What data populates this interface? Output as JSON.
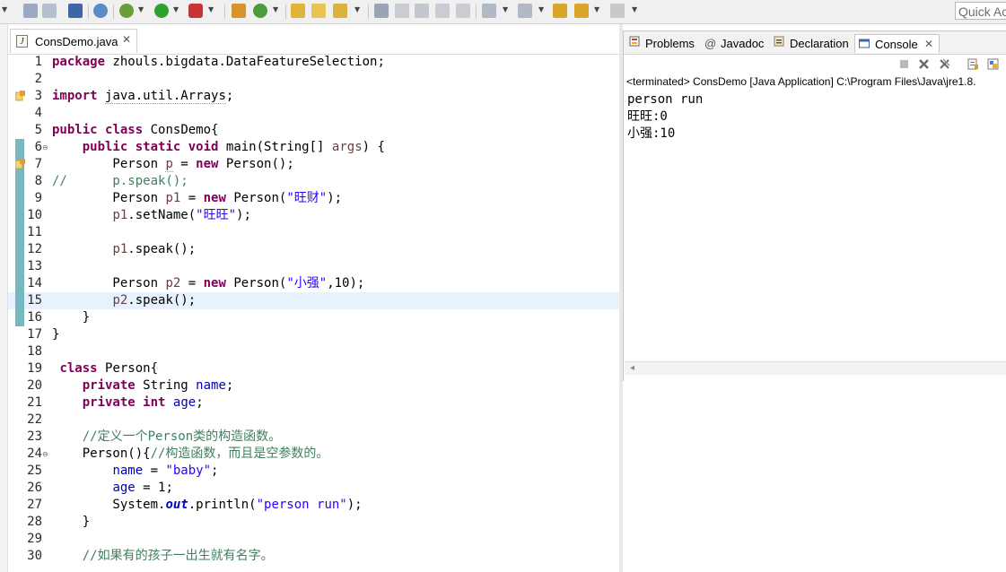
{
  "toolbar": {
    "quick_access_placeholder": "Quick Access"
  },
  "editor": {
    "tab_label": "ConsDemo.java",
    "lines": [
      {
        "n": "1",
        "t": "package zhouls.bigdata.DataFeatureSelection;"
      },
      {
        "n": "2",
        "t": ""
      },
      {
        "n": "3",
        "t": "import java.util.Arrays;"
      },
      {
        "n": "4",
        "t": ""
      },
      {
        "n": "5",
        "t": "public class ConsDemo{"
      },
      {
        "n": "6",
        "t": "    public static void main(String[] args) {"
      },
      {
        "n": "7",
        "t": "        Person p = new Person();"
      },
      {
        "n": "8",
        "t": "//      p.speak();"
      },
      {
        "n": "9",
        "t": "        Person p1 = new Person(\"旺财\");"
      },
      {
        "n": "10",
        "t": "        p1.setName(\"旺旺\");"
      },
      {
        "n": "11",
        "t": ""
      },
      {
        "n": "12",
        "t": "        p1.speak();"
      },
      {
        "n": "13",
        "t": ""
      },
      {
        "n": "14",
        "t": "        Person p2 = new Person(\"小强\",10);"
      },
      {
        "n": "15",
        "t": "        p2.speak();"
      },
      {
        "n": "16",
        "t": "    }"
      },
      {
        "n": "17",
        "t": "}"
      },
      {
        "n": "18",
        "t": ""
      },
      {
        "n": "19",
        "t": " class Person{"
      },
      {
        "n": "20",
        "t": "    private String name;"
      },
      {
        "n": "21",
        "t": "    private int age;"
      },
      {
        "n": "22",
        "t": ""
      },
      {
        "n": "23",
        "t": "    //定义一个Person类的构造函数。"
      },
      {
        "n": "24",
        "t": "    Person(){//构造函数，而且是空参数的。"
      },
      {
        "n": "25",
        "t": "        name = \"baby\";"
      },
      {
        "n": "26",
        "t": "        age = 1;"
      },
      {
        "n": "27",
        "t": "        System.out.println(\"person run\");"
      },
      {
        "n": "28",
        "t": "    }"
      },
      {
        "n": "29",
        "t": ""
      },
      {
        "n": "30",
        "t": "    //如果有的孩子一出生就有名字。"
      }
    ]
  },
  "console_view": {
    "tabs": [
      {
        "label": "Problems"
      },
      {
        "label": "Javadoc"
      },
      {
        "label": "Declaration"
      },
      {
        "label": "Console"
      }
    ],
    "terminated_line": "<terminated> ConsDemo [Java Application] C:\\Program Files\\Java\\jre1.8.",
    "output": [
      "person run",
      "旺旺:0",
      "小强:10"
    ]
  }
}
